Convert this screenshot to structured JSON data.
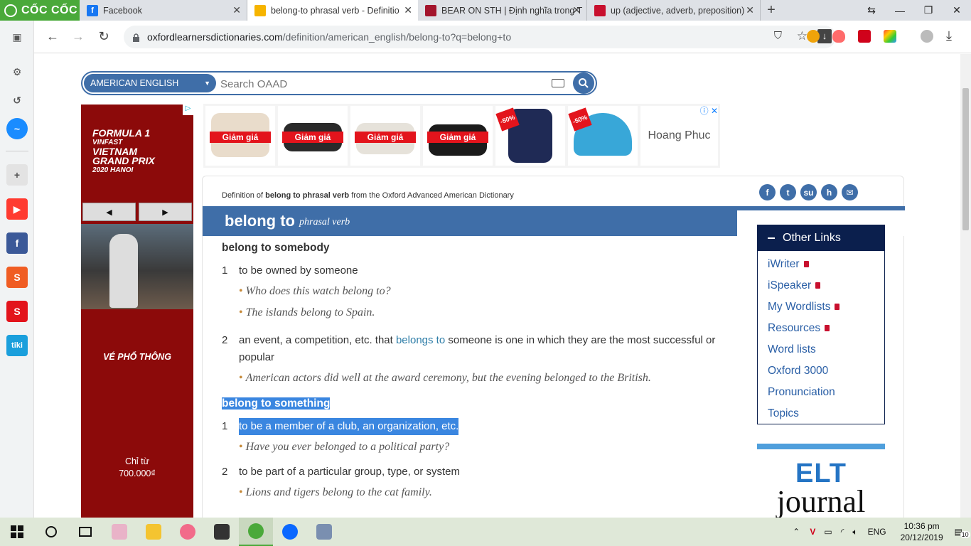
{
  "browser": {
    "brand": "CỐC CỐC",
    "tabs": [
      {
        "label": "Facebook",
        "color": "#1877f2",
        "glyph": "f"
      },
      {
        "label": "belong-to phrasal verb - Definitio",
        "color": "#f6b400",
        "glyph": "●",
        "active": true
      },
      {
        "label": "BEAR ON STH | Định nghĩa trong T",
        "color": "#a3142c",
        "glyph": "▣"
      },
      {
        "label": "up (adjective, adverb, preposition)",
        "color": "#c8102e",
        "glyph": "◆"
      }
    ],
    "url_host": "oxfordlearnersdictionaries.com",
    "url_path": "/definition/american_english/belong-to?q=belong+to"
  },
  "search": {
    "dictionary_select": "AMERICAN ENGLISH",
    "placeholder": "Search OAAD"
  },
  "left_ad": {
    "title_lines": [
      "FORMULA 1",
      "VINFAST",
      "VIETNAM",
      "GRAND PRIX",
      "2020 HANOI"
    ],
    "ticket": "VÉ PHỔ THÔNG",
    "price_prefix": "Chỉ từ",
    "price": "700.000₫",
    "prev": "◀",
    "next": "▶"
  },
  "top_ad": {
    "sale_label": "Giảm giá",
    "discount": "-50%",
    "brand": "Hoang Phuc",
    "products": [
      {
        "kind": "boots-white",
        "color": "#e9dccb",
        "label": "sale"
      },
      {
        "kind": "shoe-black",
        "color": "#2a2a2a",
        "label": "sale"
      },
      {
        "kind": "shoe-white",
        "color": "#e6e2da",
        "label": "sale"
      },
      {
        "kind": "shoe-black-2",
        "color": "#1b1b1b",
        "label": "sale"
      },
      {
        "kind": "jacket",
        "color": "#1f2a55",
        "label": "discount"
      },
      {
        "kind": "cap",
        "color": "#38a7d8",
        "label": "discount"
      }
    ]
  },
  "entry": {
    "from_prefix": "Definition of",
    "from_word": "belong to phrasal verb",
    "from_suffix": "from the Oxford Advanced American Dictionary",
    "headword": "belong to",
    "pos": "phrasal verb",
    "share_icons": [
      "f",
      "t",
      "su",
      "h",
      "✉"
    ],
    "senses": [
      {
        "title": "belong to somebody",
        "defs": [
          {
            "num": "1",
            "text": "to be owned by someone",
            "examples": [
              "Who does this watch belong to?",
              "The islands belong to Spain."
            ]
          },
          {
            "num": "2",
            "text_before": "an event, a competition, etc. that ",
            "xref": "belongs to",
            "text_after": " someone is one in which they are the most successful or popular",
            "examples": [
              "American actors did well at the award ceremony, but the evening belonged to the British."
            ]
          }
        ]
      },
      {
        "title": "belong to something",
        "defs": [
          {
            "num": "1",
            "text": "to be a member of a club, an organization, etc.",
            "examples": [
              "Have you ever belonged to a political party?"
            ]
          },
          {
            "num": "2",
            "text": "to be part of a particular group, type, or system",
            "examples": [
              "Lions and tigers belong to the cat family."
            ]
          }
        ]
      }
    ]
  },
  "other_links": {
    "title": "Other Links",
    "items": [
      {
        "label": "iWriter",
        "locked": true
      },
      {
        "label": "iSpeaker",
        "locked": true
      },
      {
        "label": "My Wordlists",
        "locked": true
      },
      {
        "label": "Resources",
        "locked": true
      },
      {
        "label": "Word lists",
        "locked": false
      },
      {
        "label": "Oxford 3000",
        "locked": false
      },
      {
        "label": "Pronunciation",
        "locked": false
      },
      {
        "label": "Topics",
        "locked": false
      }
    ]
  },
  "elt": {
    "line1": "ELT",
    "line2": "journal"
  },
  "taskbar": {
    "lang": "ENG",
    "time": "10:36 pm",
    "date": "20/12/2019",
    "notifications": "10"
  }
}
